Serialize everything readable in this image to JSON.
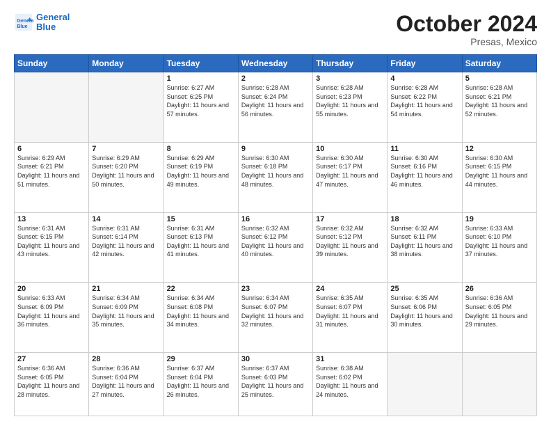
{
  "header": {
    "logo_line1": "General",
    "logo_line2": "Blue",
    "month": "October 2024",
    "location": "Presas, Mexico"
  },
  "weekdays": [
    "Sunday",
    "Monday",
    "Tuesday",
    "Wednesday",
    "Thursday",
    "Friday",
    "Saturday"
  ],
  "weeks": [
    [
      {
        "day": "",
        "info": ""
      },
      {
        "day": "",
        "info": ""
      },
      {
        "day": "1",
        "info": "Sunrise: 6:27 AM\nSunset: 6:25 PM\nDaylight: 11 hours and 57 minutes."
      },
      {
        "day": "2",
        "info": "Sunrise: 6:28 AM\nSunset: 6:24 PM\nDaylight: 11 hours and 56 minutes."
      },
      {
        "day": "3",
        "info": "Sunrise: 6:28 AM\nSunset: 6:23 PM\nDaylight: 11 hours and 55 minutes."
      },
      {
        "day": "4",
        "info": "Sunrise: 6:28 AM\nSunset: 6:22 PM\nDaylight: 11 hours and 54 minutes."
      },
      {
        "day": "5",
        "info": "Sunrise: 6:28 AM\nSunset: 6:21 PM\nDaylight: 11 hours and 52 minutes."
      }
    ],
    [
      {
        "day": "6",
        "info": "Sunrise: 6:29 AM\nSunset: 6:21 PM\nDaylight: 11 hours and 51 minutes."
      },
      {
        "day": "7",
        "info": "Sunrise: 6:29 AM\nSunset: 6:20 PM\nDaylight: 11 hours and 50 minutes."
      },
      {
        "day": "8",
        "info": "Sunrise: 6:29 AM\nSunset: 6:19 PM\nDaylight: 11 hours and 49 minutes."
      },
      {
        "day": "9",
        "info": "Sunrise: 6:30 AM\nSunset: 6:18 PM\nDaylight: 11 hours and 48 minutes."
      },
      {
        "day": "10",
        "info": "Sunrise: 6:30 AM\nSunset: 6:17 PM\nDaylight: 11 hours and 47 minutes."
      },
      {
        "day": "11",
        "info": "Sunrise: 6:30 AM\nSunset: 6:16 PM\nDaylight: 11 hours and 46 minutes."
      },
      {
        "day": "12",
        "info": "Sunrise: 6:30 AM\nSunset: 6:15 PM\nDaylight: 11 hours and 44 minutes."
      }
    ],
    [
      {
        "day": "13",
        "info": "Sunrise: 6:31 AM\nSunset: 6:15 PM\nDaylight: 11 hours and 43 minutes."
      },
      {
        "day": "14",
        "info": "Sunrise: 6:31 AM\nSunset: 6:14 PM\nDaylight: 11 hours and 42 minutes."
      },
      {
        "day": "15",
        "info": "Sunrise: 6:31 AM\nSunset: 6:13 PM\nDaylight: 11 hours and 41 minutes."
      },
      {
        "day": "16",
        "info": "Sunrise: 6:32 AM\nSunset: 6:12 PM\nDaylight: 11 hours and 40 minutes."
      },
      {
        "day": "17",
        "info": "Sunrise: 6:32 AM\nSunset: 6:12 PM\nDaylight: 11 hours and 39 minutes."
      },
      {
        "day": "18",
        "info": "Sunrise: 6:32 AM\nSunset: 6:11 PM\nDaylight: 11 hours and 38 minutes."
      },
      {
        "day": "19",
        "info": "Sunrise: 6:33 AM\nSunset: 6:10 PM\nDaylight: 11 hours and 37 minutes."
      }
    ],
    [
      {
        "day": "20",
        "info": "Sunrise: 6:33 AM\nSunset: 6:09 PM\nDaylight: 11 hours and 36 minutes."
      },
      {
        "day": "21",
        "info": "Sunrise: 6:34 AM\nSunset: 6:09 PM\nDaylight: 11 hours and 35 minutes."
      },
      {
        "day": "22",
        "info": "Sunrise: 6:34 AM\nSunset: 6:08 PM\nDaylight: 11 hours and 34 minutes."
      },
      {
        "day": "23",
        "info": "Sunrise: 6:34 AM\nSunset: 6:07 PM\nDaylight: 11 hours and 32 minutes."
      },
      {
        "day": "24",
        "info": "Sunrise: 6:35 AM\nSunset: 6:07 PM\nDaylight: 11 hours and 31 minutes."
      },
      {
        "day": "25",
        "info": "Sunrise: 6:35 AM\nSunset: 6:06 PM\nDaylight: 11 hours and 30 minutes."
      },
      {
        "day": "26",
        "info": "Sunrise: 6:36 AM\nSunset: 6:05 PM\nDaylight: 11 hours and 29 minutes."
      }
    ],
    [
      {
        "day": "27",
        "info": "Sunrise: 6:36 AM\nSunset: 6:05 PM\nDaylight: 11 hours and 28 minutes."
      },
      {
        "day": "28",
        "info": "Sunrise: 6:36 AM\nSunset: 6:04 PM\nDaylight: 11 hours and 27 minutes."
      },
      {
        "day": "29",
        "info": "Sunrise: 6:37 AM\nSunset: 6:04 PM\nDaylight: 11 hours and 26 minutes."
      },
      {
        "day": "30",
        "info": "Sunrise: 6:37 AM\nSunset: 6:03 PM\nDaylight: 11 hours and 25 minutes."
      },
      {
        "day": "31",
        "info": "Sunrise: 6:38 AM\nSunset: 6:02 PM\nDaylight: 11 hours and 24 minutes."
      },
      {
        "day": "",
        "info": ""
      },
      {
        "day": "",
        "info": ""
      }
    ]
  ]
}
